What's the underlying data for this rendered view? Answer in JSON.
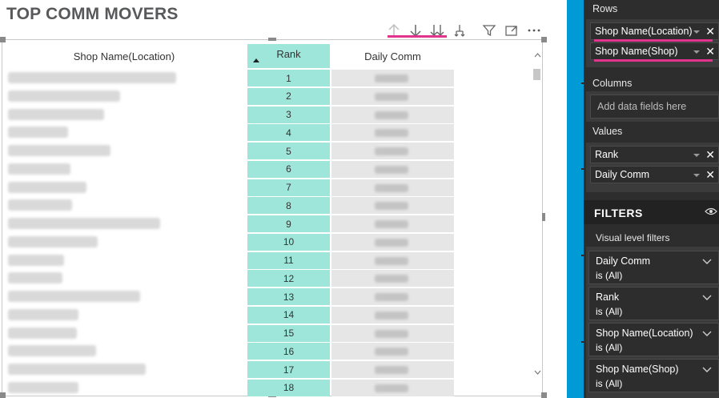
{
  "visual": {
    "title": "TOP COMM MOVERS",
    "columns": {
      "location": "Shop Name(Location)",
      "rank": "Rank",
      "daily": "Daily Comm"
    },
    "ranks": [
      "1",
      "2",
      "3",
      "4",
      "5",
      "6",
      "7",
      "8",
      "9",
      "10",
      "11",
      "12",
      "13",
      "14",
      "15",
      "16",
      "17",
      "18"
    ],
    "toolbar_icons": [
      "drill-up-icon",
      "drill-down-icon",
      "expand-all-down-icon",
      "drill-hierarchy-icon",
      "filter-icon",
      "focus-mode-icon",
      "more-options-icon"
    ],
    "accent_color": "#9ee6da",
    "highlight_color": "#e2338f"
  },
  "fields_pane": {
    "rows_label": "Rows",
    "rows": [
      "Shop Name(Location)",
      "Shop Name(Shop)"
    ],
    "columns_label": "Columns",
    "columns_placeholder": "Add data fields here",
    "values_label": "Values",
    "values": [
      "Rank",
      "Daily Comm"
    ],
    "remove_glyph": "✕"
  },
  "filters": {
    "header": "FILTERS",
    "visual_level_label": "Visual level filters",
    "items": [
      {
        "name": "Daily Comm",
        "state": "is (All)"
      },
      {
        "name": "Rank",
        "state": "is (All)"
      },
      {
        "name": "Shop Name(Location)",
        "state": "is (All)"
      },
      {
        "name": "Shop Name(Shop)",
        "state": "is (All)"
      }
    ]
  }
}
